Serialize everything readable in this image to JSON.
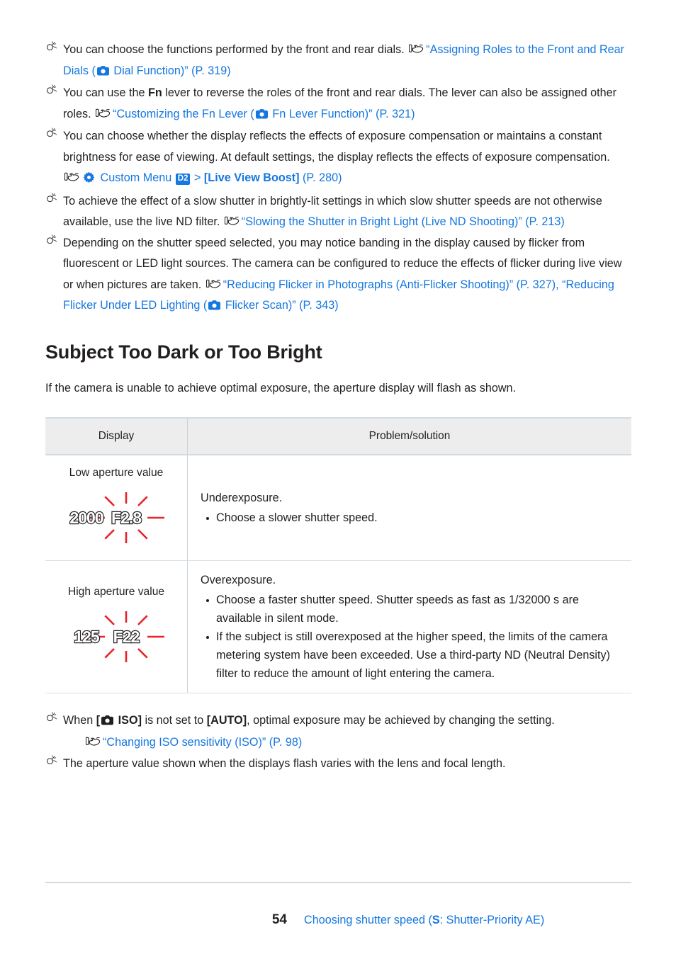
{
  "tips_top": [
    {
      "id": "dials",
      "parts": [
        {
          "t": "text",
          "v": "You can choose the functions performed by the front and rear dials. "
        },
        {
          "t": "hand"
        },
        {
          "t": "link",
          "v": "“Assigning Roles to the Front and Rear Dials ("
        },
        {
          "t": "cam",
          "color": "#1577e0"
        },
        {
          "t": "link",
          "v": " Dial Function)” (P. 319)"
        }
      ]
    },
    {
      "id": "fn-lever",
      "parts": [
        {
          "t": "text",
          "v": "You can use the "
        },
        {
          "t": "bold",
          "v": "Fn"
        },
        {
          "t": "text",
          "v": " lever to reverse the roles of the front and rear dials. The lever can also be assigned other roles. "
        },
        {
          "t": "hand"
        },
        {
          "t": "link",
          "v": "“Customizing the Fn Lever ("
        },
        {
          "t": "cam",
          "color": "#1577e0"
        },
        {
          "t": "link",
          "v": " Fn Lever Function)” (P. 321)"
        }
      ]
    },
    {
      "id": "live-view-boost",
      "parts": [
        {
          "t": "text",
          "v": "You can choose whether the display reflects the effects of exposure compensation or maintains a constant brightness for ease of viewing. At default settings, the display reflects the effects of exposure compensation. "
        },
        {
          "t": "hand"
        },
        {
          "t": "gear"
        },
        {
          "t": "link",
          "v": " Custom Menu "
        },
        {
          "t": "badge",
          "v": "D2"
        },
        {
          "t": "link",
          "v": " > "
        },
        {
          "t": "linkbold",
          "v": "[Live View Boost]"
        },
        {
          "t": "link",
          "v": " (P. 280)"
        }
      ]
    },
    {
      "id": "live-nd",
      "parts": [
        {
          "t": "text",
          "v": "To achieve the effect of a slow shutter in brightly-lit settings in which slow shutter speeds are not otherwise available, use the live ND filter. "
        },
        {
          "t": "hand"
        },
        {
          "t": "link",
          "v": "“Slowing the Shutter in Bright Light (Live ND Shooting)” (P. 213)"
        }
      ]
    },
    {
      "id": "flicker",
      "parts": [
        {
          "t": "text",
          "v": "Depending on the shutter speed selected, you may notice banding in the display caused by flicker from fluorescent or LED light sources. The camera can be configured to reduce the effects of flicker during live view or when pictures are taken. "
        },
        {
          "t": "hand"
        },
        {
          "t": "link",
          "v": "“Reducing Flicker in Photographs (Anti-Flicker Shooting)” (P. 327), “Reducing Flicker Under LED Lighting ("
        },
        {
          "t": "cam",
          "color": "#1577e0"
        },
        {
          "t": "link",
          "v": " Flicker Scan)” (P. 343)"
        }
      ]
    }
  ],
  "section": {
    "heading": "Subject Too Dark or Too Bright",
    "lead": "If the camera is unable to achieve optimal exposure, the aperture display will flash as shown."
  },
  "table": {
    "headers": [
      "Display",
      "Problem/solution"
    ],
    "rows": [
      {
        "display_label": "Low aperture value",
        "lcd": {
          "shutter": "2000",
          "aperture": "F2.8",
          "flash": true,
          "ray_color": "#e8232a"
        },
        "solution_title": "Underexposure.",
        "solution_items": [
          "Choose a slower shutter speed."
        ]
      },
      {
        "display_label": "High aperture value",
        "lcd": {
          "shutter": "125",
          "aperture": "F22",
          "flash": true,
          "ray_color": "#e8232a"
        },
        "solution_title": "Overexposure.",
        "solution_items": [
          "Choose a faster shutter speed. Shutter speeds as fast as 1/32000 s are available in silent mode.",
          "If the subject is still overexposed at the higher speed, the limits of the camera metering system have been exceeded. Use a third-party ND (Neutral Density) filter to reduce the amount of light entering the camera."
        ]
      }
    ]
  },
  "tips_bottom": [
    {
      "id": "iso-auto",
      "parts": [
        {
          "t": "text",
          "v": "When "
        },
        {
          "t": "bold",
          "v": "["
        },
        {
          "t": "cam",
          "color": "#231f20"
        },
        {
          "t": "bold",
          "v": " ISO]"
        },
        {
          "t": "text",
          "v": " is not set to "
        },
        {
          "t": "bold",
          "v": "[AUTO]"
        },
        {
          "t": "text",
          "v": ", optimal exposure may be achieved by changing the setting."
        }
      ],
      "sub": [
        {
          "t": "hand"
        },
        {
          "t": "link",
          "v": "“Changing ISO sensitivity (ISO)” (P. 98)"
        }
      ]
    },
    {
      "id": "aperture-varies",
      "parts": [
        {
          "t": "text",
          "v": "The aperture value shown when the displays flash varies with the lens and focal length."
        }
      ]
    }
  ],
  "footer": {
    "page_number": "54",
    "title_pre": "Choosing shutter speed (",
    "title_mode": "S",
    "title_post": ": Shutter-Priority AE)"
  },
  "colors": {
    "link": "#1577e0",
    "text": "#231f20",
    "table_header_bg": "#ededed",
    "table_border": "#d3dbe2",
    "flash_red": "#e8232a",
    "rule": "#d8d8d8"
  }
}
